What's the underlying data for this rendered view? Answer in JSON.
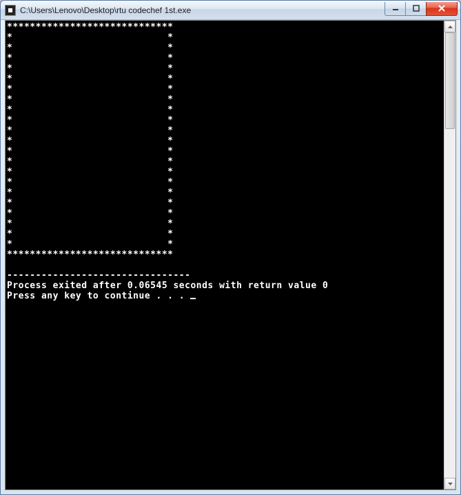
{
  "window": {
    "title": "C:\\Users\\Lenovo\\Desktop\\rtu codechef 1st.exe"
  },
  "console": {
    "lines": [
      "*****************************",
      "*                           *",
      "*                           *",
      "*                           *",
      "*                           *",
      "*                           *",
      "*                           *",
      "*                           *",
      "*                           *",
      "*                           *",
      "*                           *",
      "*                           *",
      "*                           *",
      "*                           *",
      "*                           *",
      "*                           *",
      "*                           *",
      "*                           *",
      "*                           *",
      "*                           *",
      "*                           *",
      "*                           *",
      "*****************************",
      "",
      "--------------------------------",
      "Process exited after 0.06545 seconds with return value 0",
      "Press any key to continue . . . "
    ]
  }
}
